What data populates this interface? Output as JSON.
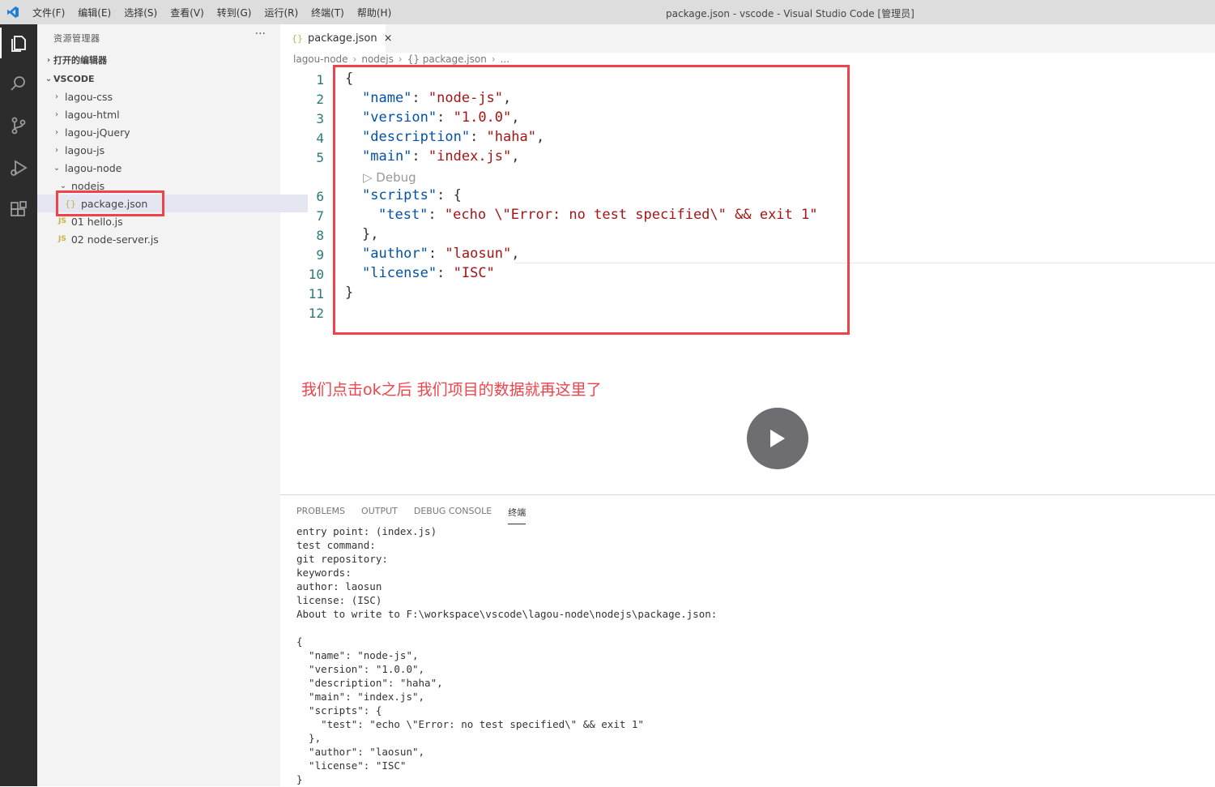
{
  "titlebar": {
    "menu": [
      "文件(F)",
      "编辑(E)",
      "选择(S)",
      "查看(V)",
      "转到(G)",
      "运行(R)",
      "终端(T)",
      "帮助(H)"
    ],
    "window_title": "package.json - vscode - Visual Studio Code [管理员]"
  },
  "sidebar": {
    "header": "资源管理器",
    "more": "···",
    "open_editors": "打开的编辑器",
    "root": "VSCODE",
    "folders": [
      "lagou-css",
      "lagou-html",
      "lagou-jQuery",
      "lagou-js",
      "lagou-node"
    ],
    "subfolder": "nodejs",
    "files": [
      {
        "icon": "{}",
        "name": "package.json"
      },
      {
        "icon": "JS",
        "name": "01 hello.js"
      },
      {
        "icon": "JS",
        "name": "02 node-server.js"
      }
    ]
  },
  "editor": {
    "tab_label": "package.json",
    "tab_close": "×",
    "breadcrumb": [
      "lagou-node",
      "nodejs",
      "{} package.json",
      "..."
    ],
    "line_numbers": [
      "1",
      "2",
      "3",
      "4",
      "5",
      "6",
      "7",
      "8",
      "9",
      "10",
      "11",
      "12"
    ],
    "debug_codelens": "▷ Debug",
    "code": {
      "open": "{",
      "name_key": "\"name\"",
      "name_val": "\"node-js\"",
      "version_key": "\"version\"",
      "version_val": "\"1.0.0\"",
      "description_key": "\"description\"",
      "description_val": "\"haha\"",
      "main_key": "\"main\"",
      "main_val": "\"index.js\"",
      "scripts_key": "\"scripts\"",
      "test_key": "\"test\"",
      "test_val": "\"echo \\\"Error: no test specified\\\" && exit 1\"",
      "scripts_close": "},",
      "author_key": "\"author\"",
      "author_val": "\"laosun\"",
      "license_key": "\"license\"",
      "license_val": "\"ISC\"",
      "close": "}"
    }
  },
  "caption": "我们点击ok之后 我们项目的数据就再这里了",
  "panel": {
    "tabs": [
      "PROBLEMS",
      "OUTPUT",
      "DEBUG CONSOLE",
      "终端"
    ],
    "terminal": "entry point: (index.js)\ntest command:\ngit repository:\nkeywords:\nauthor: laosun\nlicense: (ISC)\nAbout to write to F:\\workspace\\vscode\\lagou-node\\nodejs\\package.json:\n\n{\n  \"name\": \"node-js\",\n  \"version\": \"1.0.0\",\n  \"description\": \"haha\",\n  \"main\": \"index.js\",\n  \"scripts\": {\n    \"test\": \"echo \\\"Error: no test specified\\\" && exit 1\"\n  },\n  \"author\": \"laosun\",\n  \"license\": \"ISC\"\n}"
  },
  "colors": {
    "highlight": "#f0424a",
    "activity_bar": "#2c2c2c",
    "sidebar": "#f3f3f3"
  }
}
